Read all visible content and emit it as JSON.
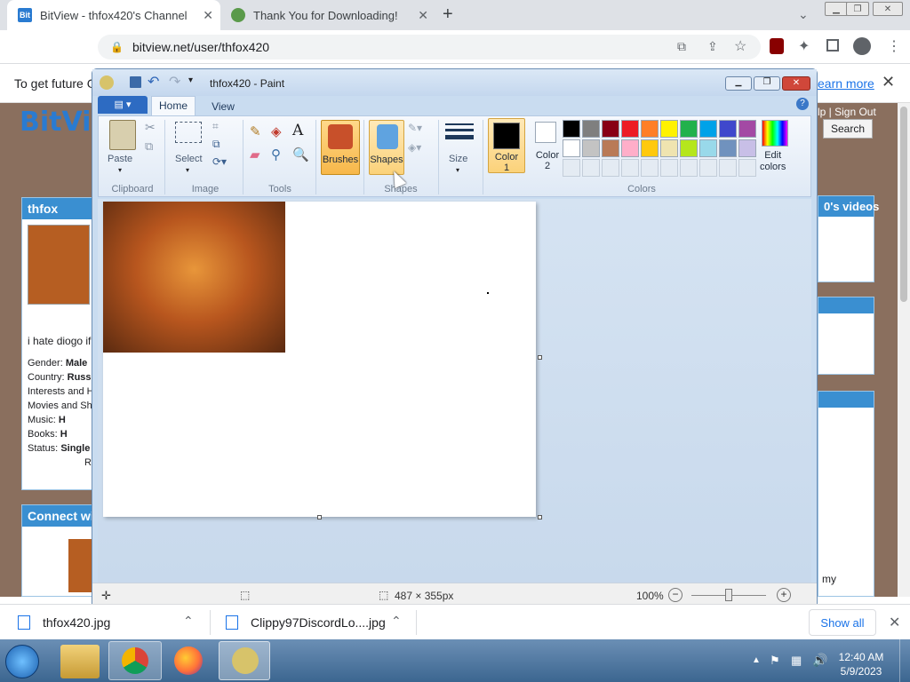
{
  "browser": {
    "tabs": [
      {
        "title": "BitView - thfox420's Channel"
      },
      {
        "title": "Thank You for Downloading!"
      }
    ],
    "url": "bitview.net/user/thfox420"
  },
  "page": {
    "infobar_text": "To get future G",
    "learn_more": "earn more",
    "logo": "BitVi",
    "help_signout": "lp | Sign Out",
    "search_button": "Search",
    "profile_header": "thfox",
    "bio": "i hate diogo if",
    "profile_fields": [
      {
        "label": "Gender:",
        "value": "Male"
      },
      {
        "label": "Country:",
        "value": "Russ"
      },
      {
        "label": "Interests and H",
        "value": ""
      },
      {
        "label": "Movies and Sh",
        "value": ""
      },
      {
        "label": "Music:",
        "value": "H"
      },
      {
        "label": "Books:",
        "value": "H"
      },
      {
        "label": "Status:",
        "value": "Single"
      }
    ],
    "more_letter": "R",
    "connect_header": "Connect wi",
    "videos_header": "0's videos",
    "right_text": "my"
  },
  "paint": {
    "title": "thfox420 - Paint",
    "tabs": [
      "Home",
      "View"
    ],
    "groups": {
      "clipboard": "Clipboard",
      "image": "Image",
      "tools": "Tools",
      "shapes": "Shapes",
      "colors": "Colors"
    },
    "buttons": {
      "paste": "Paste",
      "select": "Select",
      "brushes": "Brushes",
      "shapes": "Shapes",
      "size": "Size",
      "color1": "Color 1",
      "color1_a": "Color",
      "color1_b": "1",
      "color2_a": "Color",
      "color2_b": "2",
      "edit_colors_a": "Edit",
      "edit_colors_b": "colors"
    },
    "palette_row1": [
      "#000000",
      "#7f7f7f",
      "#880015",
      "#ed1c24",
      "#ff7f27",
      "#fff200",
      "#22b14c",
      "#00a2e8",
      "#3f48cc",
      "#a349a4"
    ],
    "palette_row2": [
      "#ffffff",
      "#c3c3c3",
      "#b97a57",
      "#ffaec9",
      "#ffc90e",
      "#efe4b0",
      "#b5e61d",
      "#99d9ea",
      "#7092be",
      "#c8bfe7"
    ],
    "status": {
      "dimensions": "487 × 355px",
      "zoom": "100%"
    }
  },
  "downloads": {
    "items": [
      "thfox420.jpg",
      "Clippy97DiscordLo....jpg"
    ],
    "show_all": "Show all"
  },
  "taskbar": {
    "time": "12:40 AM",
    "date": "5/9/2023"
  }
}
